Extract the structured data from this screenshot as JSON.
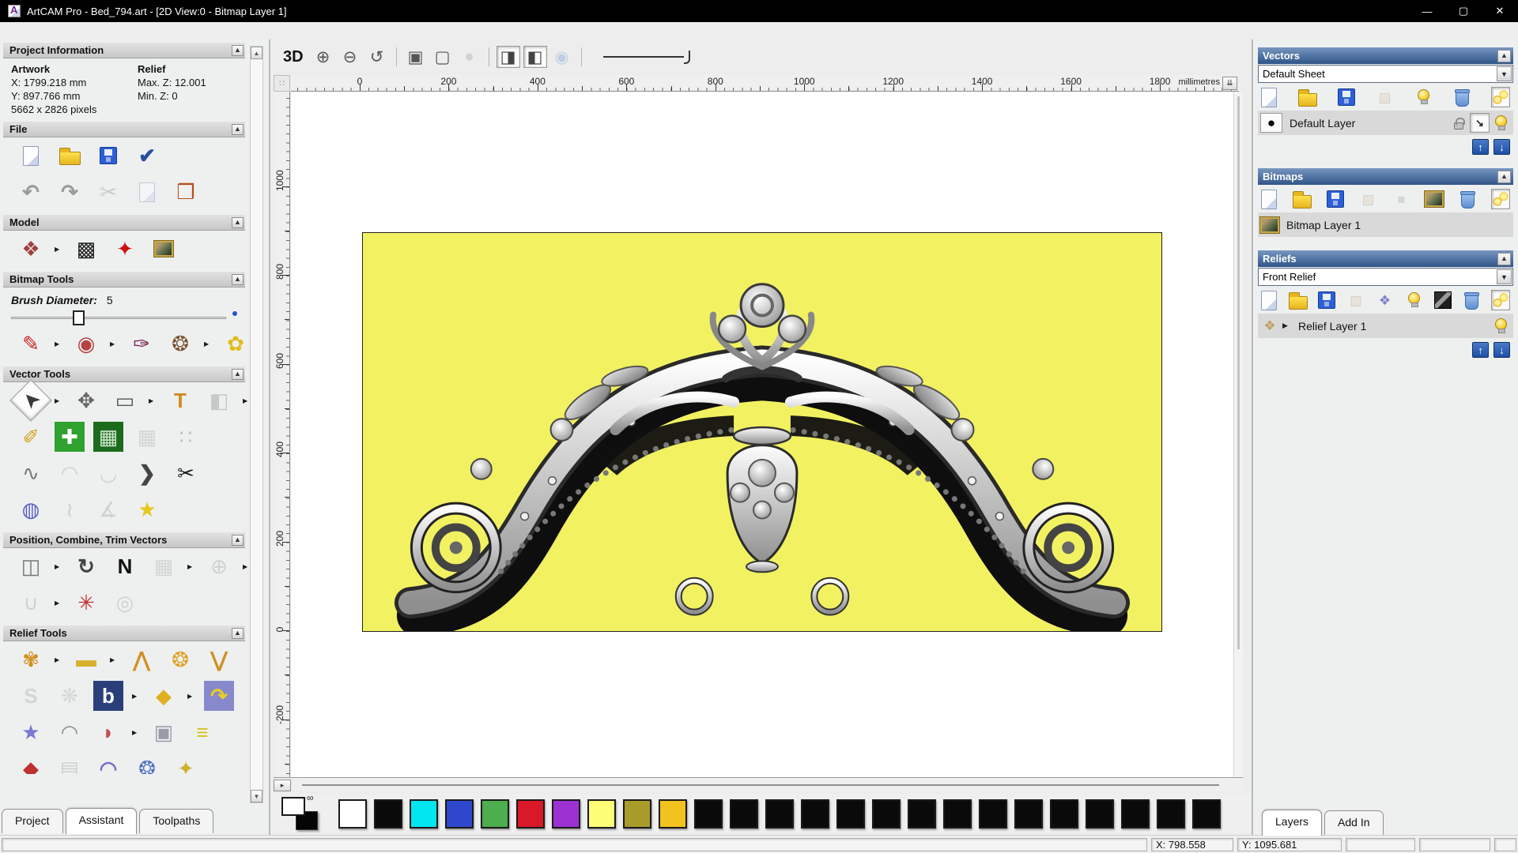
{
  "window": {
    "title": "ArtCAM Pro - Bed_794.art - [2D View:0 - Bitmap Layer 1]"
  },
  "left_panel": {
    "project_information": {
      "header": "Project Information",
      "artwork_label": "Artwork",
      "relief_label": "Relief",
      "artwork_x": "X: 1799.218 mm",
      "artwork_y": "Y: 897.766 mm",
      "artwork_pixels": "5662 x 2826 pixels",
      "relief_max": "Max. Z: 12.001",
      "relief_min": "Min. Z: 0"
    },
    "file_header": "File",
    "model_header": "Model",
    "bitmap_header": "Bitmap Tools",
    "brush": {
      "label": "Brush Diameter:",
      "value": "5"
    },
    "vector_header": "Vector Tools",
    "position_header": "Position, Combine, Trim Vectors",
    "relief_header": "Relief Tools",
    "tabs": [
      "Project",
      "Assistant",
      "Toolpaths"
    ]
  },
  "canvas": {
    "toolbar": {
      "view3d_label": "3D"
    },
    "hruler": {
      "labels": [
        "0",
        "200",
        "400",
        "600",
        "800",
        "1000",
        "1200",
        "1400",
        "1600",
        "1800"
      ],
      "units": "millimetres"
    },
    "vruler": {
      "labels": [
        "1000",
        "800",
        "600",
        "400",
        "200",
        "0",
        "-200"
      ]
    },
    "artwork_bg": "#f2f162"
  },
  "right_panel": {
    "vectors": {
      "header": "Vectors",
      "sheet": "Default Sheet",
      "layer_name": "Default Layer"
    },
    "bitmaps": {
      "header": "Bitmaps",
      "layer_name": "Bitmap Layer 1"
    },
    "reliefs": {
      "header": "Reliefs",
      "selected": "Front Relief",
      "layer_name": "Relief Layer 1"
    },
    "tabs": [
      "Layers",
      "Add In"
    ]
  },
  "palette": {
    "colors": [
      "#ffffff",
      "#0a0a0a",
      "#00e6ef",
      "#2e47cd",
      "#4cae4c",
      "#d91828",
      "#9c31d1",
      "#fdfd78",
      "#a99b2a",
      "#f2c21e",
      "#0a0a0a",
      "#0a0a0a",
      "#0a0a0a",
      "#0a0a0a",
      "#0a0a0a",
      "#0a0a0a",
      "#0a0a0a",
      "#0a0a0a",
      "#0a0a0a",
      "#0a0a0a",
      "#0a0a0a",
      "#0a0a0a",
      "#0a0a0a",
      "#0a0a0a",
      "#0a0a0a"
    ]
  },
  "status_bar": {
    "x": "X: 798.558",
    "y": "Y: 1095.681"
  },
  "icons": {
    "min": {
      "g": "—",
      "c": "#ffffff"
    },
    "max": {
      "g": "▢",
      "c": "#ffffff"
    },
    "close": {
      "g": "✕",
      "c": "#ffffff"
    },
    "collapse": {
      "g": "▲",
      "c": "#333333"
    },
    "drop": {
      "g": "▼",
      "c": "#222222"
    },
    "scroll_up": {
      "g": "▲",
      "c": "#555555"
    },
    "scroll_down": {
      "g": "▼",
      "c": "#555555"
    },
    "flyout": {
      "g": "▶",
      "c": "#1a1a1a"
    },
    "new_file": {
      "shape": "page"
    },
    "open_file": {
      "shape": "folder"
    },
    "save_file": {
      "shape": "floppy"
    },
    "prefs": {
      "g": "✔",
      "c": "#2a4fa0",
      "bold": true
    },
    "undo": {
      "g": "↶",
      "c": "#9a9a9a",
      "bold": true
    },
    "redo": {
      "g": "↷",
      "c": "#9a9a9a",
      "bold": true
    },
    "cut": {
      "g": "✂",
      "c": "#9a9a9a",
      "dim": true
    },
    "copy_gray": {
      "shape": "page",
      "dim": true
    },
    "paste": {
      "g": "❒",
      "c": "#b8501e"
    },
    "model_size": {
      "g": "❖",
      "c": "#a04040"
    },
    "adjust_model": {
      "g": "▩",
      "c": "#222222"
    },
    "lighting": {
      "g": "✦",
      "c": "#cc1111"
    },
    "load_image": {
      "shape": "pic"
    },
    "paint": {
      "g": "✎",
      "c": "#cc2222"
    },
    "flood": {
      "g": "◉",
      "c": "#b84040"
    },
    "picker": {
      "g": "✑",
      "c": "#7a2050"
    },
    "palette_ic": {
      "g": "❂",
      "c": "#7a5230"
    },
    "reduce_colors": {
      "g": "✿",
      "c": "#e0bc1c"
    },
    "select": {
      "g": "➤",
      "c": "#3a3a3a",
      "rot": -135
    },
    "transform": {
      "g": "✥",
      "c": "#666666"
    },
    "rect_tool": {
      "g": "▭",
      "c": "#555555"
    },
    "text_tool": {
      "g": "T",
      "c": "#d4881f",
      "bold": true
    },
    "mirror": {
      "g": "◧",
      "c": "#999999",
      "dim": true
    },
    "measure": {
      "g": "✐",
      "c": "#d8a020"
    },
    "add_health": {
      "g": "✚",
      "c": "#ffffff",
      "bg": "#2fa12f"
    },
    "vec_library": {
      "g": "▦",
      "c": "#cfe8cf",
      "bg": "#1c6b1c"
    },
    "distort": {
      "g": "▦",
      "c": "#b5b5b5",
      "dim": true
    },
    "paste_curve": {
      "g": "∷",
      "c": "#888888",
      "dim": true
    },
    "polyline": {
      "g": "∿",
      "c": "#777777"
    },
    "fit_arcs": {
      "g": "◠",
      "c": "#aaaaaa",
      "dim": true
    },
    "bezier": {
      "g": "◡",
      "c": "#aaaaaa",
      "dim": true
    },
    "arrowhead": {
      "g": "❯",
      "c": "#444444",
      "bold": true
    },
    "trim_scissors": {
      "g": "✂",
      "c": "#1a1a1a"
    },
    "lathe": {
      "g": "◍",
      "c": "#5a5acc"
    },
    "bend": {
      "g": "≀",
      "c": "#aaaaaa",
      "dim": true
    },
    "angle_measure": {
      "g": "∡",
      "c": "#aaaaaa",
      "dim": true
    },
    "star": {
      "g": "★",
      "c": "#e8c81c"
    },
    "align": {
      "g": "◫",
      "c": "#777777"
    },
    "text_curve": {
      "g": "↻",
      "c": "#444444",
      "bold": true
    },
    "nesting": {
      "g": "N",
      "c": "#111111",
      "bold": true
    },
    "block_copy": {
      "g": "▦",
      "c": "#b5b5b5",
      "dim": true
    },
    "weld": {
      "g": "⊕",
      "c": "#aaaaaa",
      "dim": true
    },
    "join": {
      "g": "∪",
      "c": "#aaaaaa",
      "dim": true
    },
    "vec_texture": {
      "g": "✳",
      "c": "#c03030"
    },
    "rings": {
      "g": "◎",
      "c": "#aaaaaa",
      "dim": true
    },
    "sculpt": {
      "g": "✾",
      "c": "#d09020"
    },
    "smooth_bar": {
      "g": "▬",
      "c": "#d8b030"
    },
    "merge_high": {
      "g": "⋀",
      "c": "#d09020",
      "bold": true
    },
    "scale_z": {
      "g": "❂",
      "c": "#e0a020"
    },
    "merge_low": {
      "g": "⋁",
      "c": "#d09020",
      "bold": true
    },
    "sculpt_s": {
      "g": "S",
      "c": "#b5b5b5",
      "dim": true,
      "bold": true
    },
    "weave": {
      "g": "❋",
      "c": "#bbbbbb",
      "dim": true
    },
    "relief_bitmap": {
      "g": "b",
      "c": "#ffffff",
      "bg": "#2a3f7a",
      "bold": true
    },
    "iso_form": {
      "g": "◆",
      "c": "#e0b020"
    },
    "wrap": {
      "g": "↷",
      "c": "#e8d020",
      "bg": "#8888cc",
      "bold": true
    },
    "texture_star": {
      "g": "★",
      "c": "#7a7ad0"
    },
    "two_rail": {
      "g": "◠",
      "c": "#888888"
    },
    "extrude": {
      "g": "◗",
      "c": "#c05050"
    },
    "emboss_face": {
      "g": "▣",
      "c": "#9a9aa8"
    },
    "offset_layers": {
      "g": "≡",
      "c": "#d8c020",
      "bold": true
    },
    "red_tool": {
      "g": "◆",
      "c": "#c03030"
    },
    "basket": {
      "g": "▤",
      "c": "#aaaaaa",
      "dim": true
    },
    "dome_blue": {
      "g": "◠",
      "c": "#7070c8",
      "bold": true
    },
    "circle_blue": {
      "g": "❂",
      "c": "#5070c0"
    },
    "fan_tool": {
      "g": "✦",
      "c": "#d0b030"
    },
    "zoom_in": {
      "g": "⊕",
      "c": "#555555"
    },
    "zoom_out": {
      "g": "⊖",
      "c": "#555555"
    },
    "zoom_prev": {
      "g": "↺",
      "c": "#555555"
    },
    "zoom_obj": {
      "g": "▣",
      "c": "#555555"
    },
    "zoom_page": {
      "g": "▢",
      "c": "#555555"
    },
    "zoom_free": {
      "g": "●",
      "c": "#b0b0b0",
      "dim": true
    },
    "toggle_bitmap": {
      "g": "◨",
      "c": "#444444"
    },
    "toggle_vector": {
      "g": "◧",
      "c": "#444444"
    },
    "relief_preview": {
      "g": "◉",
      "c": "#8aa8d8",
      "dim": true
    },
    "corner_cross": {
      "g": "∷",
      "c": "#999999"
    },
    "hsb_arrow": {
      "g": "▸",
      "c": "#333333"
    },
    "ruler_chevrons": {
      "g": "⇊",
      "c": "#333333"
    },
    "merge_gray": {
      "g": "▨",
      "c": "#c0a888",
      "dim": true
    },
    "gray_square": {
      "g": "■",
      "c": "#b8b8b8",
      "dim": true
    },
    "mona": {
      "shape": "pic"
    },
    "purple_layers": {
      "g": "❖",
      "c": "#8080c8"
    },
    "bw_preview": {
      "shape": "dark"
    },
    "bulb": {
      "shape": "bulb"
    },
    "bulbs": {
      "shape": "bulbs"
    },
    "trash": {
      "shape": "trash"
    },
    "lock": {
      "shape": "lock"
    },
    "snap_arrow": {
      "g": "↘",
      "c": "#222222",
      "bold": true
    },
    "black_dot": {
      "g": "●",
      "c": "#000000"
    },
    "expander": {
      "g": "▶",
      "c": "#222222"
    },
    "relief_layer_ic": {
      "g": "❖",
      "c": "#c0a060"
    },
    "up_move": {
      "g": "↑",
      "c": "#ffffff"
    },
    "down_move": {
      "g": "↓",
      "c": "#ffffff"
    },
    "link_colors": {
      "g": "∞",
      "c": "#222222"
    }
  }
}
